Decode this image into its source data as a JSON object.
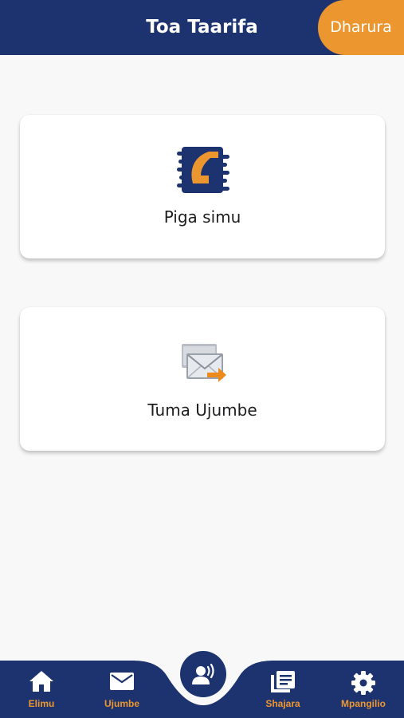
{
  "header": {
    "title": "Toa Taarifa",
    "emergency_label": "Dharura"
  },
  "actions": [
    {
      "label": "Piga simu",
      "icon": "phone-call-icon"
    },
    {
      "label": "Tuma Ujumbe",
      "icon": "send-email-icon"
    }
  ],
  "bottom_nav": {
    "items": [
      {
        "label": "Elimu",
        "icon": "home-icon"
      },
      {
        "label": "Ujumbe",
        "icon": "mail-icon"
      },
      {
        "label": "",
        "icon": "voice-report-icon"
      },
      {
        "label": "Shajara",
        "icon": "journal-icon"
      },
      {
        "label": "Mpangilio",
        "icon": "gear-icon"
      }
    ]
  },
  "colors": {
    "primary": "#1c3370",
    "accent": "#ec9630",
    "background": "#f8f8f9"
  }
}
